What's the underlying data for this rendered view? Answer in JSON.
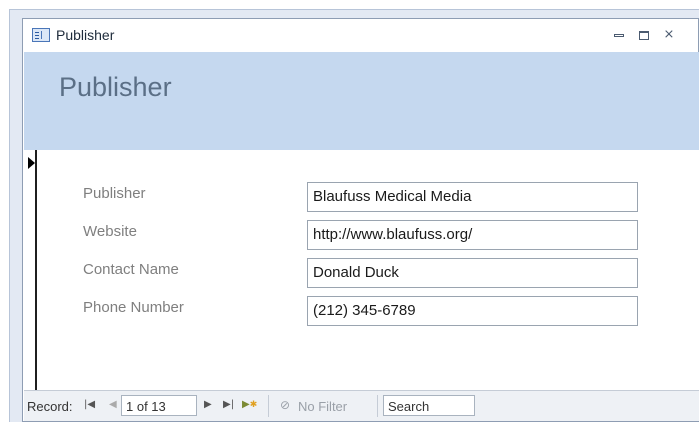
{
  "window": {
    "title": "Publisher"
  },
  "header": {
    "title": "Publisher"
  },
  "form": {
    "fields": [
      {
        "label": "Publisher",
        "value": "Blaufuss Medical Media"
      },
      {
        "label": "Website",
        "value": "http://www.blaufuss.org/"
      },
      {
        "label": "Contact Name",
        "value": "Donald Duck"
      },
      {
        "label": "Phone Number",
        "value": "(212) 345-6789"
      }
    ]
  },
  "navbar": {
    "record_label": "Record:",
    "record_position": "1 of 13",
    "filter_label": "No Filter",
    "search_value": "Search"
  },
  "colors": {
    "header_bg": "#c5d8ef",
    "header_text": "#5b6f86",
    "label_text": "#7f7f7f"
  }
}
